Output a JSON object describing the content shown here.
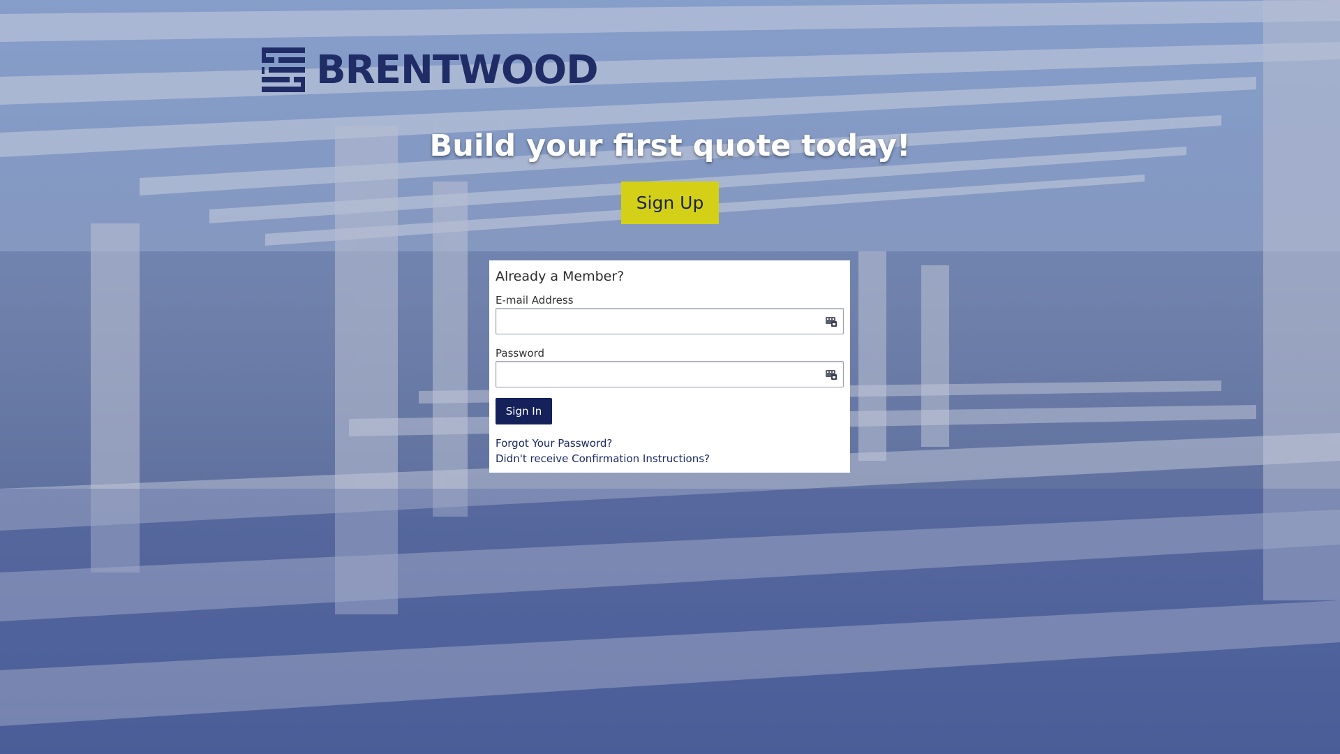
{
  "brand": {
    "name": "BRENTWOOD",
    "color": "#1f2c66"
  },
  "hero": {
    "headline": "Build your first quote today!",
    "signup_label": "Sign Up",
    "signup_color": "#d4d017"
  },
  "login": {
    "title": "Already a Member?",
    "email_label": "E-mail Address",
    "email_value": "",
    "password_label": "Password",
    "password_value": "",
    "field_icon": "autofill-icon",
    "signin_label": "Sign In",
    "signin_color": "#14215a",
    "forgot_password": "Forgot Your Password?",
    "no_confirmation": "Didn't receive Confirmation Instructions?"
  }
}
